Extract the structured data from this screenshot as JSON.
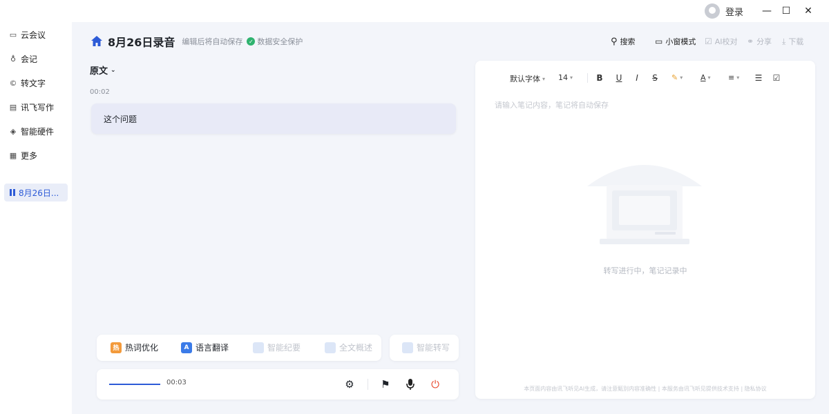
{
  "titlebar": {
    "login_label": "登录",
    "minimize_icon": "minimize-icon",
    "maximize_icon": "maximize-icon",
    "close_icon": "close-icon"
  },
  "sidebar": {
    "items": [
      {
        "label": "云会议",
        "icon": "video-icon"
      },
      {
        "label": "会记",
        "icon": "microphone-icon"
      },
      {
        "label": "转文字",
        "icon": "transcribe-icon"
      },
      {
        "label": "讯飞写作",
        "icon": "document-icon"
      },
      {
        "label": "智能硬件",
        "icon": "hardware-icon"
      },
      {
        "label": "更多",
        "icon": "grid-icon"
      }
    ],
    "session": {
      "label": "8月26日...",
      "state": "recording"
    }
  },
  "header": {
    "title": "8月26日录音",
    "note": "编辑后将自动保存",
    "safe_label": "数据安全保护"
  },
  "toolbar": {
    "search": "搜索",
    "mini_mode": "小窗模式",
    "proofread": "AI校对",
    "share": "分享",
    "download": "下载"
  },
  "original": {
    "label": "原文",
    "timestamp": "00:02",
    "text": "这个问题"
  },
  "functions": {
    "hotword": "热词优化",
    "translate": "语言翻译",
    "func3": "智能纪要",
    "func4": "全文概述",
    "func5": "智能转写"
  },
  "playbar": {
    "time": "00:03",
    "progress": 1.0
  },
  "editor": {
    "font": "默认字体",
    "size": "14",
    "placeholder": "请输入笔记内容，笔记将自动保存",
    "empty_text": "转写进行中，笔记记录中",
    "footer": "本页面内容由讯飞听见AI生成，请注意甄别内容准确性 | 本服务由讯飞听见提供技术支持 | 隐私协议"
  },
  "colors": {
    "accent": "#2d5bd7",
    "stop": "#e8492e",
    "hotword_icon": "#f39a3b",
    "translate_icon": "#3b7be8",
    "safe": "#2fb36f"
  }
}
